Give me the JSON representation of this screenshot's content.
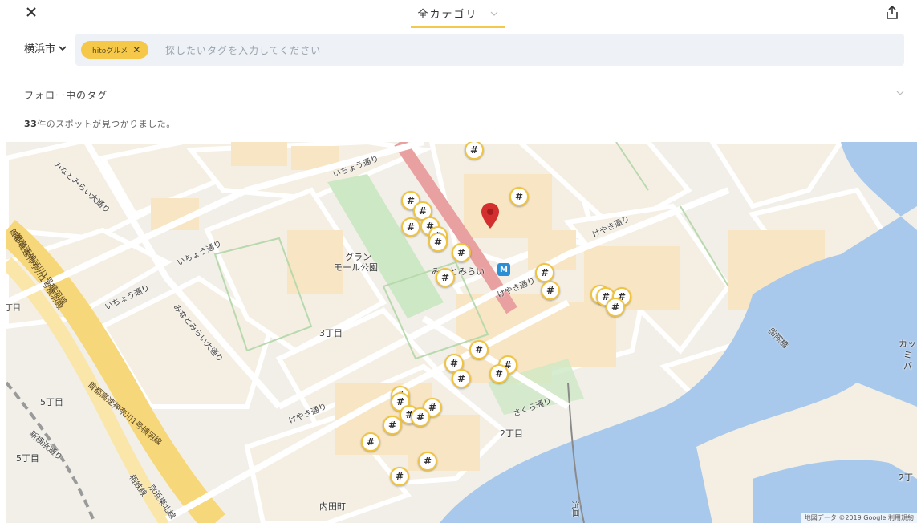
{
  "topbar": {
    "category_label": "全カテゴリ"
  },
  "filter": {
    "city": "横浜市",
    "chip_label": "hitoグルメ",
    "search_placeholder": "探したいタグを入力してください"
  },
  "follow": {
    "label": "フォロー中のタグ"
  },
  "results": {
    "count": "33",
    "suffix": "件のスポットが見つかりました。"
  },
  "map": {
    "marker_symbol": "#",
    "station_symbol": "M",
    "place_labels": [
      "グラン",
      "モール公園",
      "みなとみらい",
      "3丁目",
      "2丁目",
      "5丁目",
      "5丁目",
      "内田町",
      "カッ",
      "ミ",
      "パ",
      "2丁"
    ],
    "road_labels": [
      "いちょう通り",
      "みなとみらい大通り",
      "いちょう通り",
      "いちょう通り",
      "みなとみらい大通り",
      "けやき通り",
      "けやき通り",
      "けやき通り",
      "さくら通り",
      "国際橋",
      "新横浜通り",
      "首都高速神奈川1号横羽線",
      "首都高速神奈川1号横羽線",
      "相鉄線",
      "京浜東北線",
      "都高速神奈川1号横羽線",
      "丁目",
      "汽車"
    ],
    "attribution": "地図データ ©2019 Google   利用規約",
    "colors": {
      "water": "#a9c9ec",
      "park": "#cde8c4",
      "block": "#f5efe3",
      "building": "#f7e5c4",
      "highway": "#f6d77a",
      "marker_border": "#f1c440",
      "pin": "#d32f2f",
      "rail": "#e9a0a0"
    }
  }
}
